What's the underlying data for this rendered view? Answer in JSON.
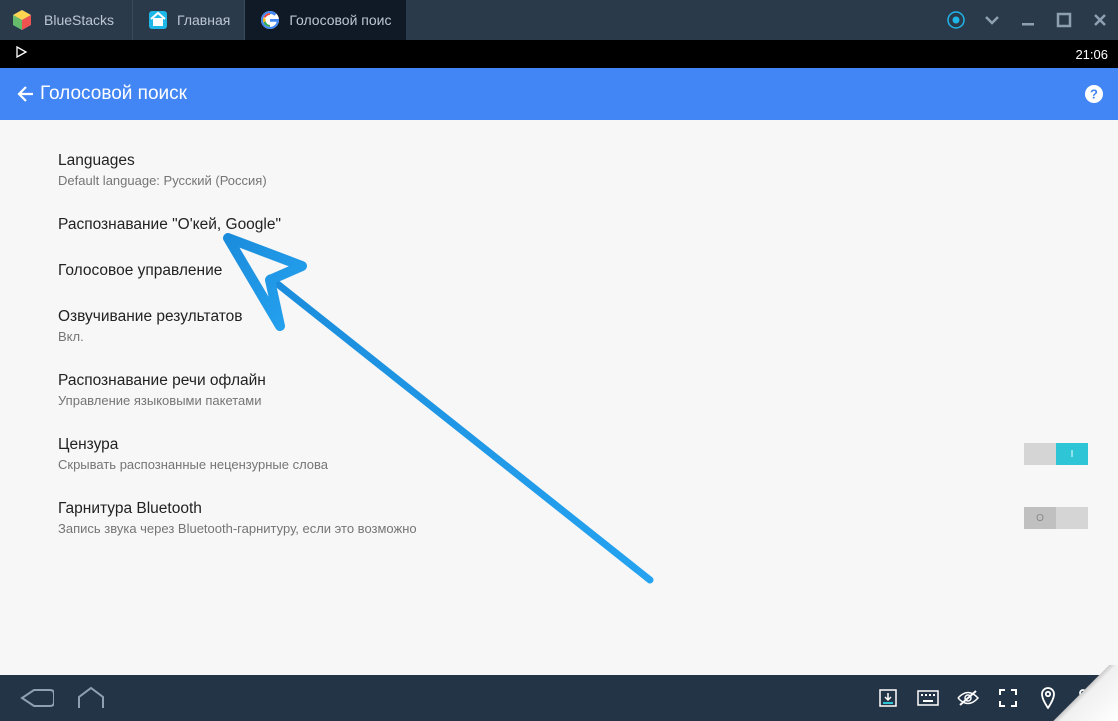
{
  "titlebar": {
    "appName": "BlueStacks",
    "tabs": [
      {
        "label": "Главная",
        "active": false
      },
      {
        "label": "Голосовой поис",
        "active": true
      }
    ]
  },
  "statusbar": {
    "time": "21:06"
  },
  "appheader": {
    "title": "Голосовой поиск"
  },
  "settings": [
    {
      "title": "Languages",
      "sub": "Default language: Русский (Россия)",
      "toggle": null
    },
    {
      "title": "Распознавание \"О'кей, Google\"",
      "sub": "",
      "toggle": null
    },
    {
      "title": "Голосовое управление",
      "sub": "",
      "toggle": null
    },
    {
      "title": "Озвучивание результатов",
      "sub": "Вкл.",
      "toggle": null
    },
    {
      "title": "Распознавание речи офлайн",
      "sub": "Управление языковыми пакетами",
      "toggle": null
    },
    {
      "title": "Цензура",
      "sub": "Скрывать распознанные нецензурные слова",
      "toggle": "on"
    },
    {
      "title": "Гарнитура Bluetooth",
      "sub": "Запись звука через Bluetooth-гарнитуру, если это возможно",
      "toggle": "off"
    }
  ],
  "toggleGlyph": {
    "on": "I",
    "off": "O"
  }
}
